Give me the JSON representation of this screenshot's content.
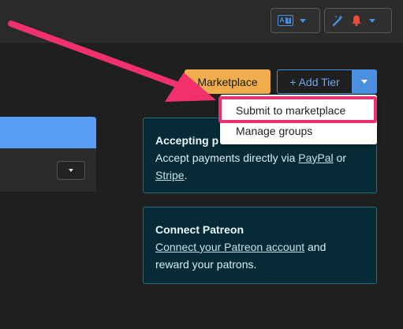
{
  "header": {
    "translate_icon_letters": [
      "A",
      "T"
    ],
    "icons": [
      "translate-icon",
      "magic-wand-icon",
      "bell-icon"
    ],
    "colors": {
      "accent": "#4a90e2",
      "bell": "#e74c3c"
    }
  },
  "toolbar": {
    "marketplace_label": "Marketplace",
    "add_tier_label": "+ Add Tier"
  },
  "dropdown": {
    "items": [
      "Submit to marketplace",
      "Manage groups"
    ]
  },
  "cards": {
    "payments": {
      "title": "Accepting p",
      "text_before": "Accept payments directly via ",
      "link1": "PayPal",
      "text_mid": " or",
      "link2": "Stripe",
      "text_after": "."
    },
    "patreon": {
      "title": "Connect Patreon",
      "link": "Connect your Patreon account",
      "text_after": " and",
      "line2": "reward your patrons."
    }
  },
  "colors": {
    "marketplace": "#f0ad4e",
    "primary": "#4a8fe0",
    "highlight": "#e8336d",
    "card_bg": "#062b36"
  }
}
